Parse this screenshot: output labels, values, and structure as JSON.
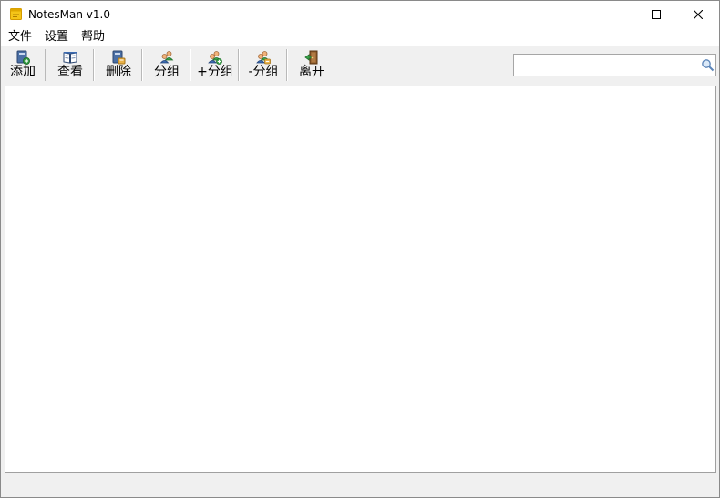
{
  "window": {
    "title": "NotesMan v1.0",
    "app_icon": "sticky-note-icon",
    "controls": {
      "minimize_icon": "minimize-icon",
      "maximize_icon": "maximize-icon",
      "close_icon": "close-icon"
    }
  },
  "menu": {
    "items": [
      {
        "label": "文件"
      },
      {
        "label": "设置"
      },
      {
        "label": "帮助"
      }
    ]
  },
  "toolbar": {
    "buttons": [
      {
        "label": "添加",
        "icon": "add-note-icon"
      },
      {
        "label": "查看",
        "icon": "open-book-icon"
      },
      {
        "label": "删除",
        "icon": "delete-note-icon"
      },
      {
        "label": "分组",
        "icon": "group-users-icon"
      },
      {
        "label": "+分组",
        "icon": "add-group-icon"
      },
      {
        "label": "-分组",
        "icon": "remove-group-icon"
      },
      {
        "label": "离开",
        "icon": "exit-door-icon"
      }
    ],
    "search": {
      "value": "",
      "placeholder": "",
      "icon": "search-icon"
    }
  },
  "statusbar": {
    "text": ""
  },
  "colors": {
    "chrome": "#f0f0f0",
    "titlebar": "#ffffff",
    "content": "#ffffff",
    "border": "#a0a0a0",
    "note_yellow": "#f5c518"
  }
}
